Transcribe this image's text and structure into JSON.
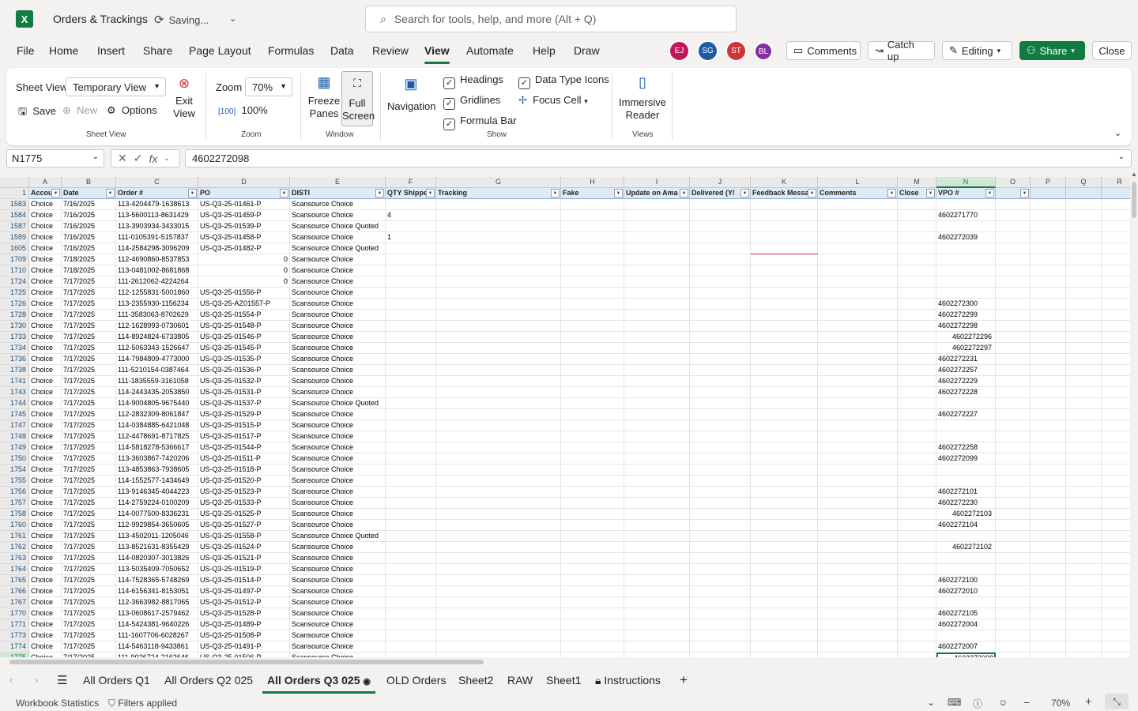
{
  "app": {
    "title": "Orders & Trackings",
    "status": "Saving...",
    "search_placeholder": "Search for tools, help, and more (Alt + Q)"
  },
  "menu": [
    "File",
    "Home",
    "Insert",
    "Share",
    "Page Layout",
    "Formulas",
    "Data",
    "Review",
    "View",
    "Automate",
    "Help",
    "Draw"
  ],
  "active_menu": "View",
  "avatars": [
    {
      "initials": "EJ",
      "color": "#c2185b"
    },
    {
      "initials": "SG",
      "color": "#1e5aa8"
    },
    {
      "initials": "ST",
      "color": "#d13438"
    },
    {
      "initials": "BL",
      "color": "#8a2da5"
    }
  ],
  "header_buttons": {
    "comments": "Comments",
    "catchup": "Catch up",
    "editing": "Editing",
    "share": "Share",
    "close": "Close"
  },
  "ribbon": {
    "sheet_view_label": "Sheet View",
    "sheet_view_value": "Temporary View",
    "save": "Save",
    "new": "New",
    "options": "Options",
    "exit_view": "Exit View",
    "group_sheet_view": "Sheet View",
    "zoom_label": "Zoom",
    "zoom_value": "70%",
    "zoom_100": "100%",
    "group_zoom": "Zoom",
    "freeze_panes": "Freeze Panes",
    "full_screen": "Full Screen",
    "group_window": "Window",
    "navigation": "Navigation",
    "headings": "Headings",
    "gridlines": "Gridlines",
    "formula_bar": "Formula Bar",
    "data_type_icons": "Data Type Icons",
    "focus_cell": "Focus Cell",
    "group_show": "Show",
    "immersive_reader": "Immersive Reader",
    "group_views": "Views"
  },
  "formula_bar": {
    "name_box": "N1775",
    "value": "4602272098"
  },
  "columns": [
    "A",
    "B",
    "C",
    "D",
    "E",
    "F",
    "G",
    "H",
    "I",
    "J",
    "K",
    "L",
    "M",
    "N",
    "O",
    "P",
    "Q",
    "R"
  ],
  "header_row": {
    "num": "1",
    "cells": [
      "Accou",
      "Date",
      "Order #",
      "PO",
      "DISTI",
      "QTY Shippe",
      "Tracking",
      "Fake",
      "Update on Ama",
      "Delivered (Y/",
      "Feedback Messa",
      "Comments",
      "Close",
      "VPO #",
      "",
      "",
      "",
      ""
    ]
  },
  "rows": [
    {
      "n": "1583",
      "a": "Choice",
      "b": "7/16/2025",
      "c": "113-4204479-1638613",
      "d": "US-Q3-25-01461-P",
      "e": "Scansource Choice",
      "f": "",
      "n_val": "",
      "indent": false,
      "dz": false
    },
    {
      "n": "1584",
      "a": "Choice",
      "b": "7/16/2025",
      "c": "113-5600113-8631429",
      "d": "US-Q3-25-01459-P",
      "e": "Scansource Choice",
      "f": "4",
      "n_val": "4602271770",
      "indent": false,
      "dz": false
    },
    {
      "n": "1587",
      "a": "Choice",
      "b": "7/16/2025",
      "c": "113-3903934-3433015",
      "d": "US-Q3-25-01539-P",
      "e": "Scansource Choice Quoted",
      "f": "",
      "n_val": "",
      "indent": false,
      "dz": false
    },
    {
      "n": "1589",
      "a": "Choice",
      "b": "7/16/2025",
      "c": "111-0105391-5157837",
      "d": "US-Q3-25-01458-P",
      "e": "Scansource Choice",
      "f": "1",
      "n_val": "4602272039",
      "indent": false,
      "dz": false
    },
    {
      "n": "1605",
      "a": "Choice",
      "b": "7/16/2025",
      "c": "114-2584298-3096209",
      "d": "US-Q3-25-01482-P",
      "e": "Scansource Choice Quoted",
      "f": "",
      "n_val": "",
      "indent": false,
      "dz": false
    },
    {
      "n": "1709",
      "a": "Choice",
      "b": "7/18/2025",
      "c": "112-4690860-8537853",
      "d": "0",
      "e": "Scansource Choice",
      "f": "",
      "n_val": "",
      "indent": false,
      "dz": true
    },
    {
      "n": "1710",
      "a": "Choice",
      "b": "7/18/2025",
      "c": "113-0481002-8681868",
      "d": "0",
      "e": "Scansource Choice",
      "f": "",
      "n_val": "",
      "indent": false,
      "dz": true
    },
    {
      "n": "1724",
      "a": "Choice",
      "b": "7/17/2025",
      "c": "111-2612062-4224264",
      "d": "0",
      "e": "Scansource Choice",
      "f": "",
      "n_val": "",
      "indent": false,
      "dz": true
    },
    {
      "n": "1725",
      "a": "Choice",
      "b": "7/17/2025",
      "c": "112-1255831-5001860",
      "d": "US-Q3-25-01556-P",
      "e": "Scansource Choice",
      "f": "",
      "n_val": "",
      "indent": false,
      "dz": false
    },
    {
      "n": "1726",
      "a": "Choice",
      "b": "7/17/2025",
      "c": "113-2355930-1156234",
      "d": "US-Q3-25-AZ01557-P",
      "e": "Scansource Choice",
      "f": "",
      "n_val": "4602272300",
      "indent": false,
      "dz": false
    },
    {
      "n": "1728",
      "a": "Choice",
      "b": "7/17/2025",
      "c": "111-3583063-8702629",
      "d": "US-Q3-25-01554-P",
      "e": "Scansource Choice",
      "f": "",
      "n_val": "4602272299",
      "indent": false,
      "dz": false
    },
    {
      "n": "1730",
      "a": "Choice",
      "b": "7/17/2025",
      "c": "112-1628993-0730601",
      "d": "US-Q3-25-01548-P",
      "e": "Scansource Choice",
      "f": "",
      "n_val": "4602272298",
      "indent": false,
      "dz": false
    },
    {
      "n": "1733",
      "a": "Choice",
      "b": "7/17/2025",
      "c": "114-8924824-6733805",
      "d": "US-Q3-25-01546-P",
      "e": "Scansource Choice",
      "f": "",
      "n_val": "4602272296",
      "indent": true,
      "dz": false
    },
    {
      "n": "1734",
      "a": "Choice",
      "b": "7/17/2025",
      "c": "112-5063343-1526647",
      "d": "US-Q3-25-01545-P",
      "e": "Scansource Choice",
      "f": "",
      "n_val": "4602272297",
      "indent": true,
      "dz": false
    },
    {
      "n": "1736",
      "a": "Choice",
      "b": "7/17/2025",
      "c": "114-7984809-4773000",
      "d": "US-Q3-25-01535-P",
      "e": "Scansource Choice",
      "f": "",
      "n_val": "4602272231",
      "indent": false,
      "dz": false
    },
    {
      "n": "1738",
      "a": "Choice",
      "b": "7/17/2025",
      "c": "111-5210154-0387464",
      "d": "US-Q3-25-01536-P",
      "e": "Scansource Choice",
      "f": "",
      "n_val": "4602272257",
      "indent": false,
      "dz": false
    },
    {
      "n": "1741",
      "a": "Choice",
      "b": "7/17/2025",
      "c": "111-1835559-3161058",
      "d": "US-Q3-25-01532-P",
      "e": "Scansource Choice",
      "f": "",
      "n_val": "4602272229",
      "indent": false,
      "dz": false
    },
    {
      "n": "1743",
      "a": "Choice",
      "b": "7/17/2025",
      "c": "114-2443435-2053850",
      "d": "US-Q3-25-01531-P",
      "e": "Scansource Choice",
      "f": "",
      "n_val": "4602272228",
      "indent": false,
      "dz": false
    },
    {
      "n": "1744",
      "a": "Choice",
      "b": "7/17/2025",
      "c": "114-9004805-9675440",
      "d": "US-Q3-25-01537-P",
      "e": "Scansource Choice Quoted",
      "f": "",
      "n_val": "",
      "indent": false,
      "dz": false
    },
    {
      "n": "1745",
      "a": "Choice",
      "b": "7/17/2025",
      "c": "112-2832309-8061847",
      "d": "US-Q3-25-01529-P",
      "e": "Scansource Choice",
      "f": "",
      "n_val": "4602272227",
      "indent": false,
      "dz": false
    },
    {
      "n": "1747",
      "a": "Choice",
      "b": "7/17/2025",
      "c": "114-0384885-6421048",
      "d": "US-Q3-25-01515-P",
      "e": "Scansource Choice",
      "f": "",
      "n_val": "",
      "indent": false,
      "dz": false
    },
    {
      "n": "1748",
      "a": "Choice",
      "b": "7/17/2025",
      "c": "112-4478691-8717825",
      "d": "US-Q3-25-01517-P",
      "e": "Scansource Choice",
      "f": "",
      "n_val": "",
      "indent": false,
      "dz": false
    },
    {
      "n": "1749",
      "a": "Choice",
      "b": "7/17/2025",
      "c": "114-5818278-5366617",
      "d": "US-Q3-25-01544-P",
      "e": "Scansource Choice",
      "f": "",
      "n_val": "4602272258",
      "indent": false,
      "dz": false
    },
    {
      "n": "1750",
      "a": "Choice",
      "b": "7/17/2025",
      "c": "113-3603867-7420206",
      "d": "US-Q3-25-01511-P",
      "e": "Scansource Choice",
      "f": "",
      "n_val": "4602272099",
      "indent": false,
      "dz": false
    },
    {
      "n": "1754",
      "a": "Choice",
      "b": "7/17/2025",
      "c": "113-4853863-7938605",
      "d": "US-Q3-25-01518-P",
      "e": "Scansource Choice",
      "f": "",
      "n_val": "",
      "indent": false,
      "dz": false
    },
    {
      "n": "1755",
      "a": "Choice",
      "b": "7/17/2025",
      "c": "114-1552577-1434649",
      "d": "US-Q3-25-01520-P",
      "e": "Scansource Choice",
      "f": "",
      "n_val": "",
      "indent": false,
      "dz": false
    },
    {
      "n": "1756",
      "a": "Choice",
      "b": "7/17/2025",
      "c": "113-9146345-4044223",
      "d": "US-Q3-25-01523-P",
      "e": "Scansource Choice",
      "f": "",
      "n_val": "4602272101",
      "indent": false,
      "dz": false
    },
    {
      "n": "1757",
      "a": "Choice",
      "b": "7/17/2025",
      "c": "114-2759224-0100209",
      "d": "US-Q3-25-01533-P",
      "e": "Scansource Choice",
      "f": "",
      "n_val": "4602272230",
      "indent": false,
      "dz": false
    },
    {
      "n": "1758",
      "a": "Choice",
      "b": "7/17/2025",
      "c": "114-0077500-8336231",
      "d": "US-Q3-25-01525-P",
      "e": "Scansource Choice",
      "f": "",
      "n_val": "4602272103",
      "indent": true,
      "dz": false
    },
    {
      "n": "1760",
      "a": "Choice",
      "b": "7/17/2025",
      "c": "112-9929854-3650605",
      "d": "US-Q3-25-01527-P",
      "e": "Scansource Choice",
      "f": "",
      "n_val": "4602272104",
      "indent": false,
      "dz": false
    },
    {
      "n": "1761",
      "a": "Choice",
      "b": "7/17/2025",
      "c": "113-4502011-1205046",
      "d": "US-Q3-25-01558-P",
      "e": "Scansource Choice Quoted",
      "f": "",
      "n_val": "",
      "indent": false,
      "dz": false
    },
    {
      "n": "1762",
      "a": "Choice",
      "b": "7/17/2025",
      "c": "113-8521631-8355429",
      "d": "US-Q3-25-01524-P",
      "e": "Scansource Choice",
      "f": "",
      "n_val": "4602272102",
      "indent": true,
      "dz": false
    },
    {
      "n": "1763",
      "a": "Choice",
      "b": "7/17/2025",
      "c": "114-0820307-3013826",
      "d": "US-Q3-25-01521-P",
      "e": "Scansource Choice",
      "f": "",
      "n_val": "",
      "indent": false,
      "dz": false
    },
    {
      "n": "1764",
      "a": "Choice",
      "b": "7/17/2025",
      "c": "113-5035409-7050652",
      "d": "US-Q3-25-01519-P",
      "e": "Scansource Choice",
      "f": "",
      "n_val": "",
      "indent": false,
      "dz": false
    },
    {
      "n": "1765",
      "a": "Choice",
      "b": "7/17/2025",
      "c": "114-7528365-5748269",
      "d": "US-Q3-25-01514-P",
      "e": "Scansource Choice",
      "f": "",
      "n_val": "4602272100",
      "indent": false,
      "dz": false
    },
    {
      "n": "1766",
      "a": "Choice",
      "b": "7/17/2025",
      "c": "114-6156341-8153051",
      "d": "US-Q3-25-01497-P",
      "e": "Scansource Choice",
      "f": "",
      "n_val": "4602272010",
      "indent": false,
      "dz": false
    },
    {
      "n": "1767",
      "a": "Choice",
      "b": "7/17/2025",
      "c": "112-3663982-8817065",
      "d": "US-Q3-25-01512-P",
      "e": "Scansource Choice",
      "f": "",
      "n_val": "",
      "indent": false,
      "dz": false
    },
    {
      "n": "1770",
      "a": "Choice",
      "b": "7/17/2025",
      "c": "113-0608617-2579462",
      "d": "US-Q3-25-01528-P",
      "e": "Scansource Choice",
      "f": "",
      "n_val": "4602272105",
      "indent": false,
      "dz": false
    },
    {
      "n": "1771",
      "a": "Choice",
      "b": "7/17/2025",
      "c": "114-5424381-9640226",
      "d": "US-Q3-25-01489-P",
      "e": "Scansource Choice",
      "f": "",
      "n_val": "4602272004",
      "indent": false,
      "dz": false
    },
    {
      "n": "1773",
      "a": "Choice",
      "b": "7/17/2025",
      "c": "111-1607706-6028267",
      "d": "US-Q3-25-01508-P",
      "e": "Scansource Choice",
      "f": "",
      "n_val": "",
      "indent": false,
      "dz": false
    },
    {
      "n": "1774",
      "a": "Choice",
      "b": "7/17/2025",
      "c": "114-5463118-9433861",
      "d": "US-Q3-25-01491-P",
      "e": "Scansource Choice",
      "f": "",
      "n_val": "4602272007",
      "indent": false,
      "dz": false
    },
    {
      "n": "1775",
      "a": "Choice",
      "b": "7/17/2025",
      "c": "111-9026724-2162646",
      "d": "US-Q3-25-01506-P",
      "e": "Scansource Choice",
      "f": "",
      "n_val": "4602272098",
      "indent": true,
      "dz": false
    }
  ],
  "sheet_tabs": [
    "All Orders Q1",
    "All Orders Q2 025",
    "All Orders Q3 025",
    "OLD Orders",
    "Sheet2",
    "RAW",
    "Sheet1",
    "Instructions"
  ],
  "active_sheet": "All Orders Q3 025",
  "status": {
    "left1": "Workbook Statistics",
    "left2": "Filters applied",
    "zoom": "70%"
  },
  "colors": {
    "accent": "#107c41",
    "header_fill": "#ddebf7"
  }
}
